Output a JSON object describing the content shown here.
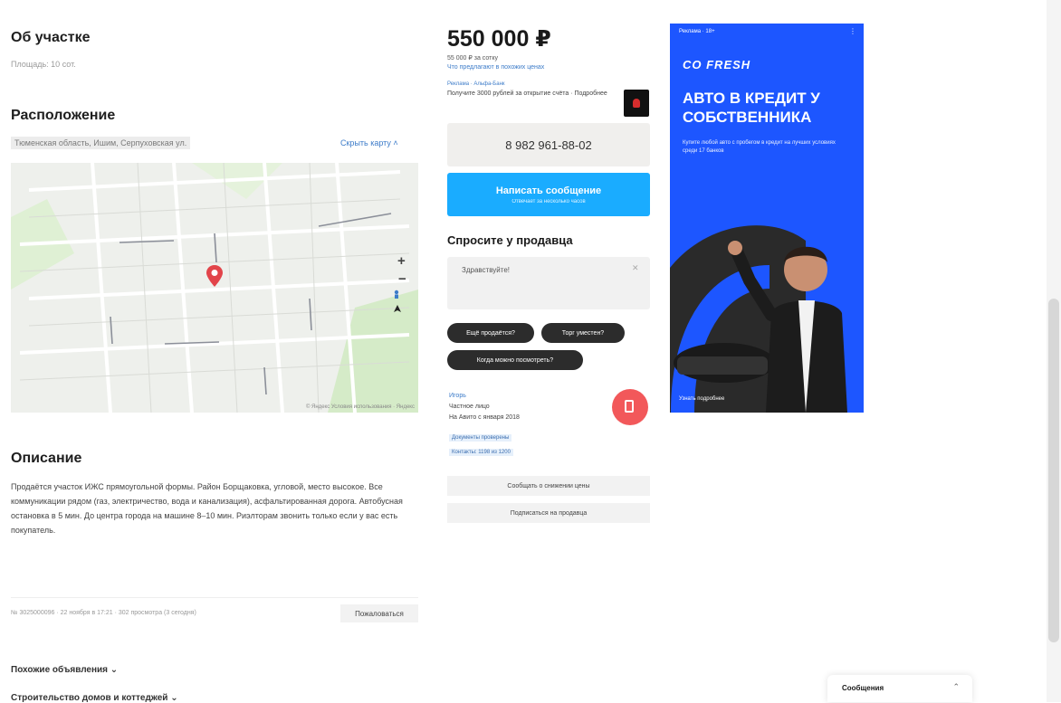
{
  "about": {
    "title": "Об участке",
    "area_line": "Площадь: 10 сот."
  },
  "location": {
    "title": "Расположение",
    "address": "Тюменская область, Ишим, Серпуховская ул.",
    "hide_map": "Скрыть карту ˄",
    "map": {
      "zoom_in": "+",
      "zoom_out": "−",
      "attribution": "© Яндекс Условия использования · Яндекс"
    }
  },
  "description": {
    "title": "Описание",
    "text": "Продаётся участок ИЖС прямоугольной формы. Район Борщаковка, угловой, место высокое. Все коммуникации рядом (газ, электричество, вода и канализация), асфальтированная дорога. Автобусная остановка в 5 мин. До центра города на машине 8–10 мин. Риэлторам звонить только если у вас есть покупатель.",
    "meta": "№ 3025000096 · 22 ноября в 17:21 · 302 просмотра (3 сегодня)",
    "complain": "Пожаловаться"
  },
  "listing": {
    "price": "550 000 ₽",
    "price_per": "55 000 ₽ за сотку",
    "price_hint": "Что предлагают в похожих ценах",
    "promo_label": "Реклама · Альфа-Банк",
    "promo_text": "Получите 3000 рублей за открытие счёта · Подробнее",
    "phone": "8 982 961-88-02",
    "message_btn": "Написать сообщение",
    "message_btn_sub": "Отвечает за несколько часов",
    "ask_title": "Спросите у продавца",
    "ask_placeholder": "Здравствуйте!",
    "chips": [
      "Ещё продаётся?",
      "Торг уместен?",
      "Когда можно посмотреть?"
    ],
    "seller_name": "Игорь",
    "seller_type": "Частное лицо",
    "seller_since": "На Авито с января 2018",
    "tags": [
      "Документы проверены",
      "Контакты: 1198 из 1200"
    ],
    "notify_btn": "Сообщать о снижении цены",
    "subscribe_btn": "Подписаться на продавца"
  },
  "ad": {
    "label": "Реклама · 18+",
    "brand": "CO FRESH",
    "headline": "АВТО В КРЕДИТ У СОБСТВЕННИКА",
    "sub": "Купите любой авто с пробегом в кредит на лучших условиях среди 17 банков",
    "cta": "Узнать подробнее"
  },
  "footer": {
    "similar": "Похожие объявления ⌄",
    "more": "Строительство домов и коттеджей ⌄"
  },
  "messages_panel": {
    "label": "Сообщения"
  },
  "colors": {
    "accent": "#1aacff",
    "fab": "#f2585a",
    "ad_bg": "#1d56ff",
    "pin": "#e2444a"
  }
}
